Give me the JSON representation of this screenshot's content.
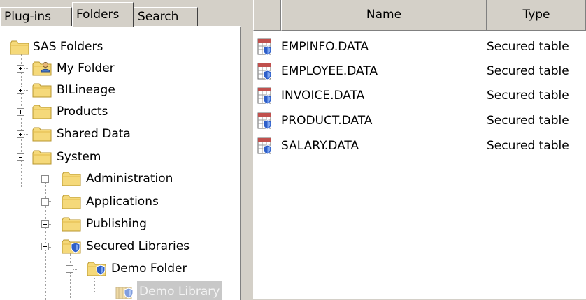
{
  "tabs": [
    {
      "label": "Plug-ins"
    },
    {
      "label": "Folders"
    },
    {
      "label": "Search"
    }
  ],
  "tree": {
    "root": "SAS Folders",
    "my_folder": "My Folder",
    "bilineage": "BILineage",
    "products": "Products",
    "shared_data": "Shared Data",
    "system": "System",
    "administration": "Administration",
    "applications": "Applications",
    "publishing": "Publishing",
    "secured_libraries": "Secured Libraries",
    "demo_folder": "Demo Folder",
    "demo_library": "Demo Library"
  },
  "list": {
    "columns": {
      "name": "Name",
      "type": "Type"
    },
    "rows": [
      {
        "name": "EMPINFO.DATA",
        "type": "Secured table"
      },
      {
        "name": "EMPLOYEE.DATA",
        "type": "Secured table"
      },
      {
        "name": "INVOICE.DATA",
        "type": "Secured table"
      },
      {
        "name": "PRODUCT.DATA",
        "type": "Secured table"
      },
      {
        "name": "SALARY.DATA",
        "type": "Secured table"
      }
    ]
  },
  "colors": {
    "folder": "#f5d97a",
    "shield": "#2e5fc9",
    "selection": "#c8c8c8"
  },
  "icons": {
    "folder": "folder-icon",
    "secured_folder": "secured-folder-icon",
    "secured_table": "secured-table-icon",
    "user_folder": "user-folder-icon"
  }
}
